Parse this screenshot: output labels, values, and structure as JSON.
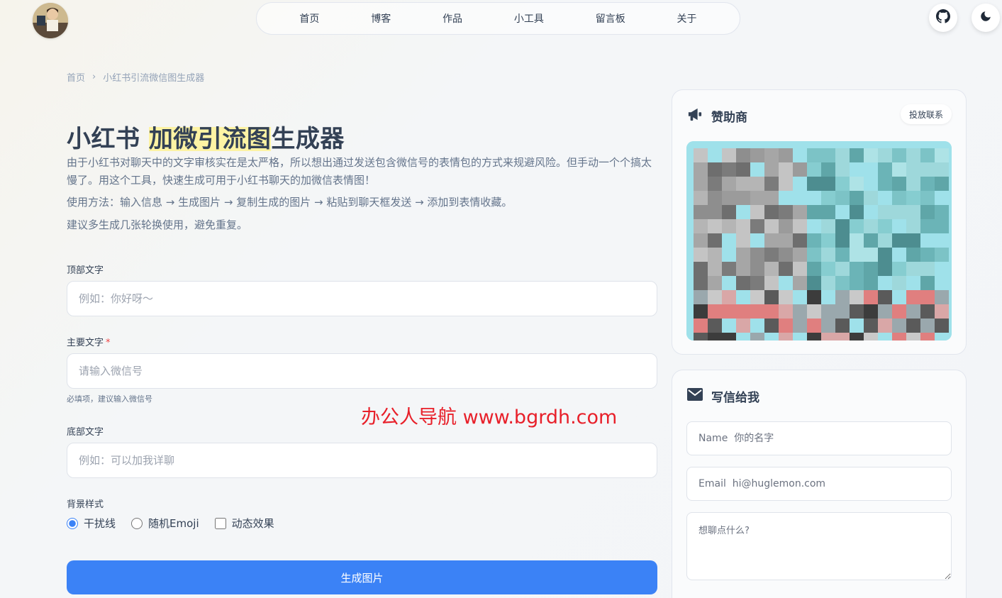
{
  "nav": {
    "items": [
      "首页",
      "博客",
      "作品",
      "小工具",
      "留言板",
      "关于"
    ]
  },
  "breadcrumb": {
    "home": "首页",
    "separator": "›",
    "current": "小红书引流微信图生成器"
  },
  "page": {
    "title_part1": "小红书 ",
    "title_highlight": "加微引流图",
    "title_part2": "生成器",
    "desc1": "由于小红书对聊天中的文字审核实在是太严格，所以想出通过发送包含微信号的表情包的方式来规避风险。但手动一个个搞太慢了。用这个工具，快速生成可用于小红书聊天的加微信表情图！",
    "desc2": "使用方法：输入信息 → 生成图片 → 复制生成的图片 → 粘贴到聊天框发送 → 添加到表情收藏。",
    "desc3": "建议多生成几张轮换使用，避免重复。"
  },
  "form": {
    "top_label": "顶部文字",
    "top_placeholder": "例如：你好呀～",
    "main_label": "主要文字",
    "main_required": "*",
    "main_placeholder": "请输入微信号",
    "main_hint": "必填项，建议输入微信号",
    "bottom_label": "底部文字",
    "bottom_placeholder": "例如：可以加我详聊",
    "bg_label": "背景样式",
    "options": [
      "干扰线",
      "随机Emoji",
      "动态效果"
    ],
    "selected_option": "干扰线",
    "generate_label": "生成图片"
  },
  "watermark": "办公人导航 www.bgrdh.com",
  "sponsor": {
    "title": "赞助商",
    "contact_label": "投放联系",
    "icon": "megaphone-icon"
  },
  "contact": {
    "title": "写信给我",
    "icon": "mail-icon",
    "name_placeholder": "Name  你的名字",
    "email_placeholder": "Email  hi@huglemon.com",
    "message_placeholder": "想聊点什么?"
  },
  "colors": {
    "accent": "#3b82f6",
    "highlight": "#fdf3a4",
    "watermark": "#e8202a",
    "text": "#334155"
  }
}
